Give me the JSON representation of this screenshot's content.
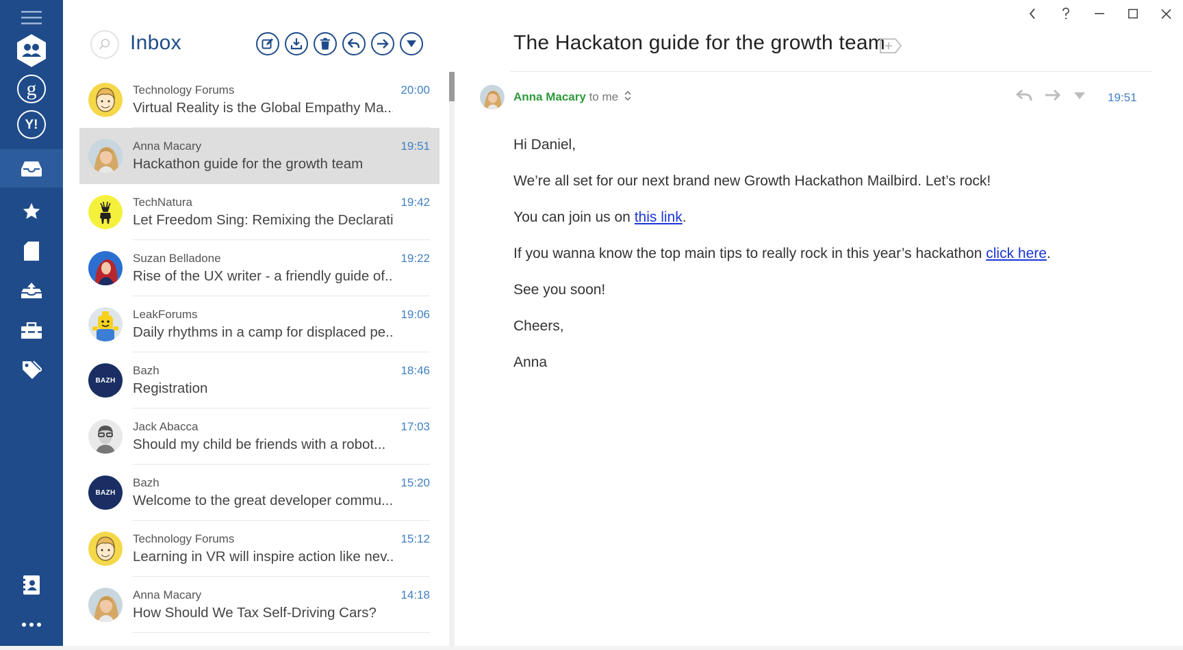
{
  "app": {
    "accent_color": "#1f4b8a",
    "rail_items": [
      {
        "name": "menu-icon"
      },
      {
        "name": "people-icon"
      },
      {
        "name": "google-account-icon",
        "glyph": "g"
      },
      {
        "name": "yahoo-account-icon",
        "glyph": "Y!"
      },
      {
        "name": "inbox-icon"
      },
      {
        "name": "star-icon"
      },
      {
        "name": "document-icon"
      },
      {
        "name": "sent-icon"
      },
      {
        "name": "toolbox-icon"
      },
      {
        "name": "tag-icon"
      },
      {
        "name": "contacts-icon"
      },
      {
        "name": "more-icon",
        "glyph": "•••"
      }
    ]
  },
  "list": {
    "title": "Inbox",
    "toolbar": [
      "compose-icon",
      "download-icon",
      "delete-icon",
      "reply-icon",
      "forward-icon",
      "dropdown-icon"
    ],
    "items": [
      {
        "sender": "Technology Forums",
        "subject": "Virtual Reality is the Global Empathy Ma...",
        "time": "20:00",
        "avatar": "cartoon-man",
        "selected": false
      },
      {
        "sender": "Anna Macary",
        "subject": "Hackathon guide for the growth team",
        "time": "19:51",
        "avatar": "woman-blonde",
        "selected": true
      },
      {
        "sender": "TechNatura",
        "subject": "Let Freedom Sing: Remixing the Declarati...",
        "time": "19:42",
        "avatar": "deer-yellow",
        "selected": false
      },
      {
        "sender": "Suzan Belladone",
        "subject": "Rise of the UX writer - a friendly guide of...",
        "time": "19:22",
        "avatar": "woman-redhair",
        "selected": false
      },
      {
        "sender": "LeakForums",
        "subject": "Daily rhythms in a camp for displaced pe...",
        "time": "19:06",
        "avatar": "lego-figure",
        "selected": false
      },
      {
        "sender": "Bazh",
        "subject": "Registration",
        "time": "18:46",
        "avatar": "bazh-logo",
        "avatar_text": "BAZH",
        "selected": false
      },
      {
        "sender": "Jack Abacca",
        "subject": "Should my child be friends with a robot...",
        "time": "17:03",
        "avatar": "man-glasses",
        "selected": false
      },
      {
        "sender": "Bazh",
        "subject": "Welcome to the great developer commu...",
        "time": "15:20",
        "avatar": "bazh-logo",
        "avatar_text": "BAZH",
        "selected": false
      },
      {
        "sender": "Technology Forums",
        "subject": "Learning in VR will inspire action like nev...",
        "time": "15:12",
        "avatar": "cartoon-man",
        "selected": false
      },
      {
        "sender": "Anna Macary",
        "subject": "How Should We Tax Self-Driving Cars?",
        "time": "14:18",
        "avatar": "woman-blonde",
        "selected": false
      }
    ]
  },
  "message": {
    "title": "The Hackaton guide for the growth team",
    "from_name": "Anna Macary",
    "to": "to me",
    "time": "19:51",
    "greeting": "Hi Daniel,",
    "line1": "We’re all set for our next brand new Growth Hackathon Mailbird. Let’s rock!",
    "line2_before": "You can join us on ",
    "line2_link": "this link",
    "line2_after": ".",
    "line3_before": "If you wanna know the top main tips to really rock in this year’s hackathon ",
    "line3_link": "click here",
    "line3_after": ".",
    "line4": "See you soon!",
    "line5": "Cheers,",
    "signature": "Anna",
    "link_color": "#1a35d6",
    "sender_color": "#2d9a3a"
  },
  "window": {
    "controls": [
      "back-icon",
      "help-icon",
      "minimize-icon",
      "maximize-icon",
      "close-icon"
    ]
  }
}
